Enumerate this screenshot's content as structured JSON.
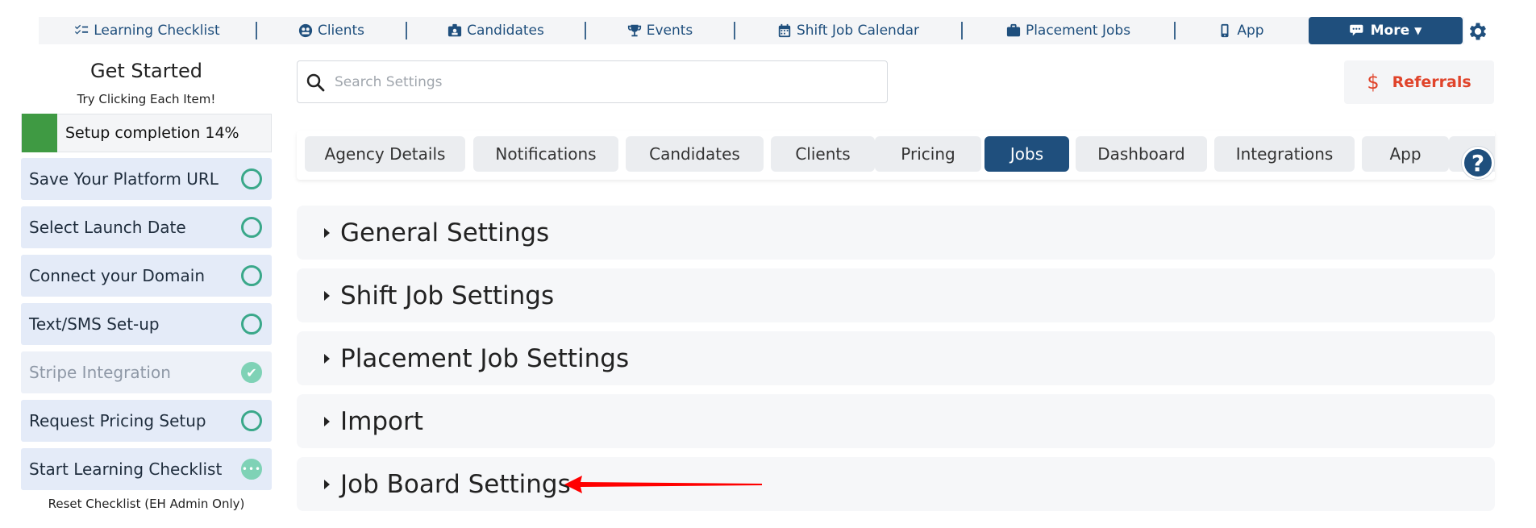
{
  "topnav": {
    "items": [
      {
        "label": "Learning Checklist",
        "icon": "checklist-icon"
      },
      {
        "label": "Clients",
        "icon": "globe-icon"
      },
      {
        "label": "Candidates",
        "icon": "id-badge-icon"
      },
      {
        "label": "Events",
        "icon": "trophy-icon"
      },
      {
        "label": "Shift Job Calendar",
        "icon": "calendar-icon"
      },
      {
        "label": "Placement Jobs",
        "icon": "briefcase-icon"
      },
      {
        "label": "App",
        "icon": "mobile-icon"
      }
    ],
    "more_label": "More",
    "more_icon": "comments-icon",
    "settings_icon": "gear-icon"
  },
  "sidebar": {
    "title": "Get Started",
    "subtitle": "Try Clicking Each Item!",
    "progress_label": "Setup completion 14%",
    "progress_fraction": 0.14,
    "steps": [
      {
        "label": "Save Your Platform URL",
        "status": "todo"
      },
      {
        "label": "Select Launch Date",
        "status": "todo"
      },
      {
        "label": "Connect your Domain",
        "status": "todo"
      },
      {
        "label": "Text/SMS Set-up",
        "status": "todo"
      },
      {
        "label": "Stripe Integration",
        "status": "done"
      },
      {
        "label": "Request Pricing Setup",
        "status": "todo"
      },
      {
        "label": "Start Learning Checklist",
        "status": "in-progress"
      }
    ],
    "reset_label": "Reset Checklist (EH Admin Only)"
  },
  "search": {
    "placeholder": "Search Settings",
    "value": ""
  },
  "referrals": {
    "label": "Referrals",
    "icon": "dollar-icon"
  },
  "tabs": [
    {
      "label": "Agency Details",
      "active": false
    },
    {
      "label": "Notifications",
      "active": false
    },
    {
      "label": "Candidates",
      "active": false
    },
    {
      "label": "Clients",
      "active": false
    },
    {
      "label": "Pricing",
      "active": false
    },
    {
      "label": "Jobs",
      "active": true
    },
    {
      "label": "Dashboard",
      "active": false
    },
    {
      "label": "Integrations",
      "active": false
    },
    {
      "label": "App",
      "active": false
    },
    {
      "label": "",
      "active": false
    }
  ],
  "help": {
    "label": "?"
  },
  "accordions": [
    {
      "label": "General Settings"
    },
    {
      "label": "Shift Job Settings"
    },
    {
      "label": "Placement Job Settings"
    },
    {
      "label": "Import"
    },
    {
      "label": "Job Board Settings"
    }
  ],
  "colors": {
    "brand": "#1f4f7d",
    "progress": "#3f9a43",
    "step_bg": "#e4ebf8",
    "step_status": "#3aa88a",
    "referrals": "#e0442b",
    "annotation_arrow": "#ff0000"
  }
}
